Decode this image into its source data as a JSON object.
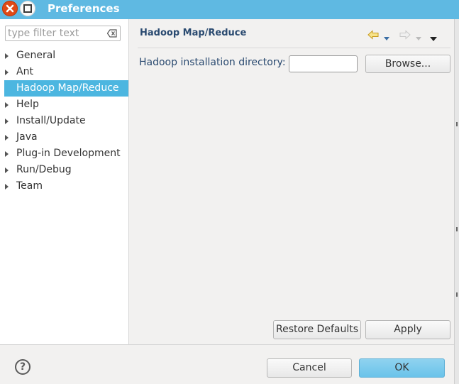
{
  "window": {
    "title": "Preferences"
  },
  "filter": {
    "placeholder": "type filter text"
  },
  "tree": {
    "items": [
      {
        "label": "General",
        "expandable": true
      },
      {
        "label": "Ant",
        "expandable": true
      },
      {
        "label": "Hadoop Map/Reduce",
        "expandable": false,
        "selected": true
      },
      {
        "label": "Help",
        "expandable": true
      },
      {
        "label": "Install/Update",
        "expandable": true
      },
      {
        "label": "Java",
        "expandable": true
      },
      {
        "label": "Plug-in Development",
        "expandable": true
      },
      {
        "label": "Run/Debug",
        "expandable": true
      },
      {
        "label": "Team",
        "expandable": true
      }
    ]
  },
  "page": {
    "title": "Hadoop Map/Reduce",
    "field_label": "Hadoop installation directory:",
    "field_value": "",
    "browse_label": "Browse...",
    "restore_label": "Restore Defaults",
    "apply_label": "Apply"
  },
  "footer": {
    "help_glyph": "?",
    "cancel_label": "Cancel",
    "ok_label": "OK"
  },
  "colors": {
    "titlebar": "#5fb9e2",
    "selection": "#4cb6e0",
    "ok_button": "#6ac3ea",
    "close_button": "#df4a16"
  }
}
